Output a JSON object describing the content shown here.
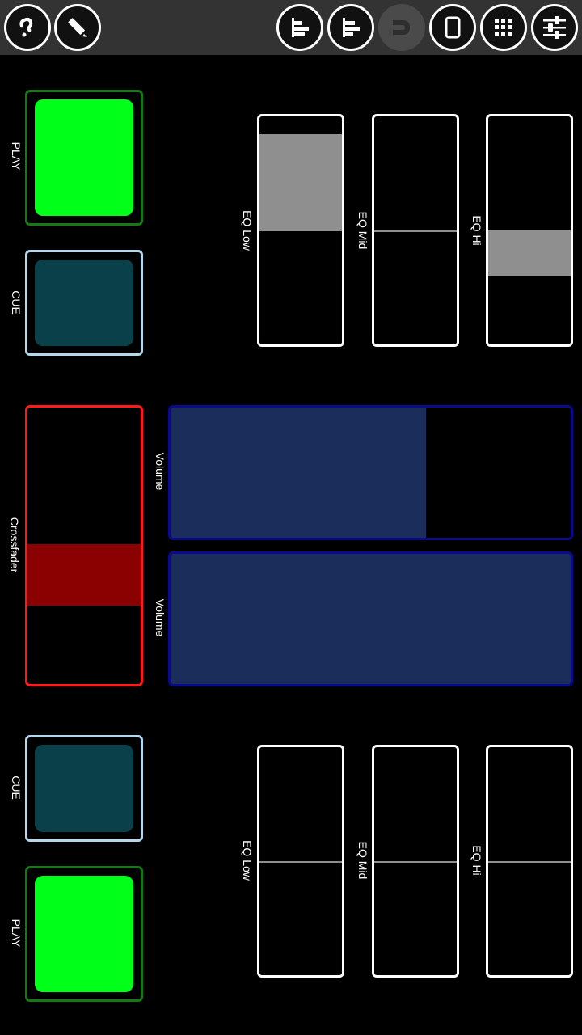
{
  "toolbar": {
    "buttons": [
      {
        "name": "help-button",
        "icon": "question-icon"
      },
      {
        "name": "edit-button",
        "icon": "pencil-icon"
      },
      {
        "name": "align-left-button",
        "icon": "align-left-icon"
      },
      {
        "name": "align-left-alt-button",
        "icon": "align-left-icon"
      },
      {
        "name": "connect-button",
        "icon": "magnet-icon"
      },
      {
        "name": "device-button",
        "icon": "tablet-icon"
      },
      {
        "name": "grid-button",
        "icon": "grid-icon"
      },
      {
        "name": "mixer-button",
        "icon": "sliders-icon"
      }
    ]
  },
  "deck_a": {
    "play_label": "PLAY",
    "cue_label": "CUE",
    "eq_low_label": "EQ Low",
    "eq_mid_label": "EQ Mid",
    "eq_hi_label": "EQ Hi",
    "eq_low_fill": [
      0.08,
      0.5
    ],
    "eq_mid_fill": [
      0.5,
      0.5
    ],
    "eq_hi_fill": [
      0.5,
      0.69
    ]
  },
  "deck_b": {
    "play_label": "PLAY",
    "cue_label": "CUE",
    "eq_low_label": "EQ Low",
    "eq_mid_label": "EQ Mid",
    "eq_hi_label": "EQ Hi",
    "eq_low_fill": [
      0.5,
      0.5
    ],
    "eq_mid_fill": [
      0.5,
      0.5
    ],
    "eq_hi_fill": [
      0.5,
      0.5
    ]
  },
  "mixer": {
    "crossfader_label": "Crossfader",
    "crossfader_position": 0.5,
    "volume_a_label": "Volume",
    "volume_a_value": 0.64,
    "volume_b_label": "Volume",
    "volume_b_value": 1.0
  },
  "colors": {
    "play": "#00ff19",
    "play_border": "#137a14",
    "cue": "#0a4049",
    "cue_border": "#b4d7eb",
    "crossfader_border": "#ff1a1a",
    "crossfader_thumb": "#8b0000",
    "volume_fill": "#1b2d5a",
    "volume_border": "#0a0a8a",
    "eq_fill": "#8f8f8f"
  }
}
